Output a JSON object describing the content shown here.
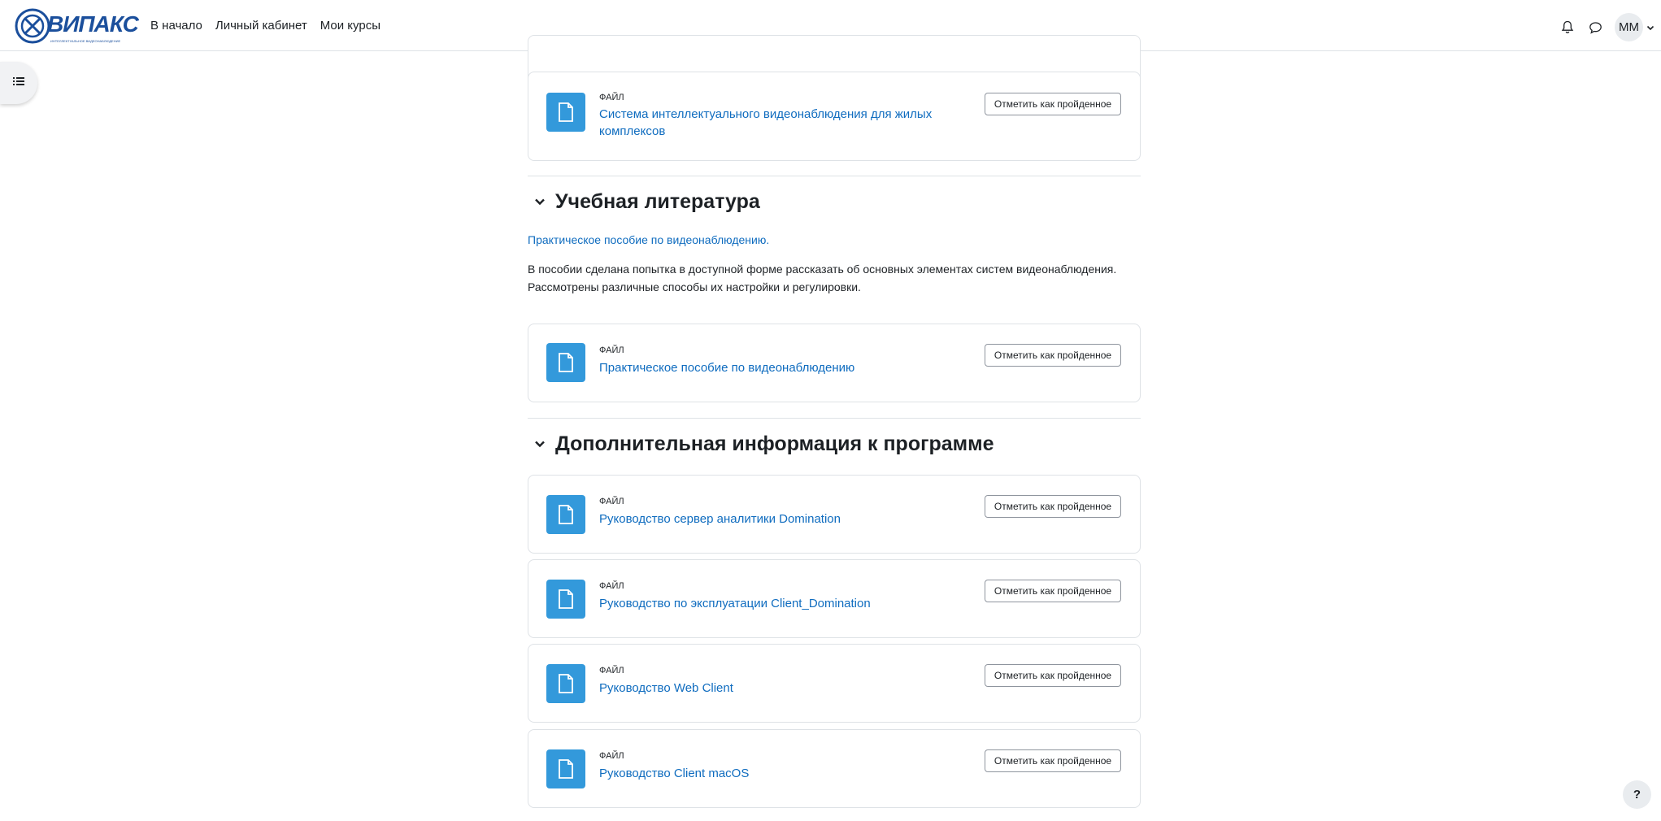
{
  "brand": {
    "name": "ВИПАКС",
    "tagline": "ИНТЕЛЛЕКТУАЛЬНОЕ ВИДЕОНАБЛЮДЕНИЕ",
    "color": "#1b4f9c"
  },
  "nav": {
    "links": [
      {
        "label": "В начало"
      },
      {
        "label": "Личный кабинет"
      },
      {
        "label": "Мои курсы"
      }
    ],
    "user_initials": "ММ"
  },
  "accent_color": "#3399db",
  "link_color": "#0f6cbf",
  "activities_top": [
    {
      "type": "Файл",
      "name": "Система интеллектуального видеонаблюдения для жилых комплексов",
      "button": "Отметить как пройденное"
    }
  ],
  "sections": [
    {
      "title": "Учебная литература",
      "summary_link": "Практическое пособие по видеонаблюдению.",
      "summary_line1": "В пособии сделана попытка в доступной форме рассказать об основных элементах систем видеонаблюдения.",
      "summary_line2": "Рассмотрены различные способы их настройки и регулировки.",
      "activities": [
        {
          "type": "Файл",
          "name": "Практическое пособие по видеонаблюдению",
          "button": "Отметить как пройденное"
        }
      ]
    },
    {
      "title": "Дополнительная информация к программе",
      "activities": [
        {
          "type": "Файл",
          "name": "Руководство сервер аналитики Domination",
          "button": "Отметить как пройденное"
        },
        {
          "type": "Файл",
          "name": "Руководство по эксплуатации Client_Domination",
          "button": "Отметить как пройденное"
        },
        {
          "type": "Файл",
          "name": "Руководство Web Client",
          "button": "Отметить как пройденное"
        },
        {
          "type": "Файл",
          "name": "Руководство Client macOS",
          "button": "Отметить как пройденное"
        }
      ]
    }
  ],
  "help_label": "?"
}
